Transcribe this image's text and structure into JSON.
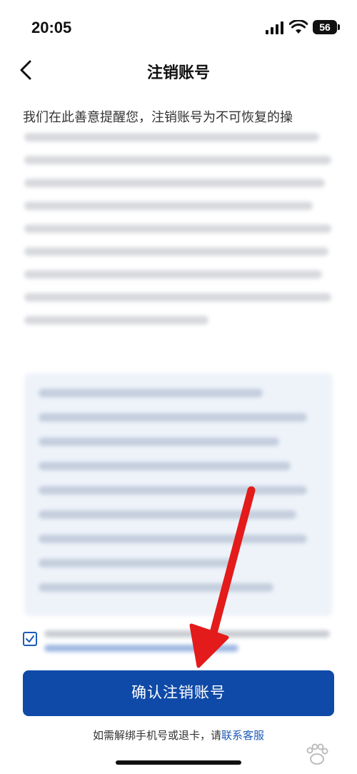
{
  "status_bar": {
    "time": "20:05",
    "battery": "56"
  },
  "nav": {
    "title": "注销账号"
  },
  "content": {
    "intro": "我们在此善意提醒您，注销账号为不可恢复的操"
  },
  "actions": {
    "confirm_label": "确认注销账号"
  },
  "footer": {
    "prefix": "如需解绑手机号或退卡，请",
    "link": "联系客服"
  },
  "colors": {
    "primary": "#0f4aa8",
    "link": "#1e5bb8",
    "arrow": "#e31b1b"
  },
  "icons": {
    "back": "chevron-left-icon",
    "checkbox": "checkmark-icon",
    "signal": "signal-icon",
    "wifi": "wifi-icon",
    "battery": "battery-icon"
  }
}
